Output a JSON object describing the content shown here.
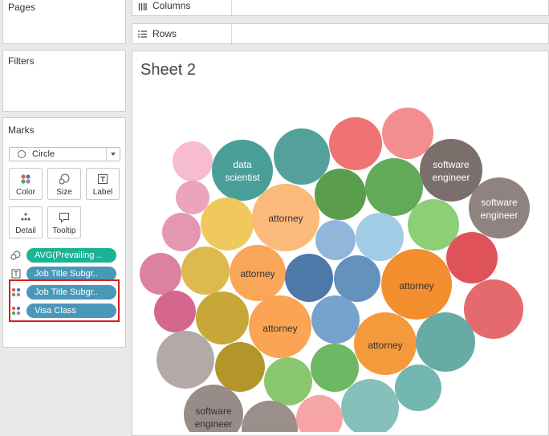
{
  "side": {
    "pages_title": "Pages",
    "filters_title": "Filters",
    "marks_title": "Marks",
    "mark_type": "Circle",
    "buttons": [
      {
        "label": "Color",
        "icon": "color-icon"
      },
      {
        "label": "Size",
        "icon": "size-icon"
      },
      {
        "label": "Label",
        "icon": "label-icon"
      },
      {
        "label": "Detail",
        "icon": "detail-icon"
      },
      {
        "label": "Tooltip",
        "icon": "tooltip-icon"
      }
    ],
    "pills": [
      {
        "text": "AVG(Prevailing ..",
        "icon": "size-icon",
        "color": "#1bb393"
      },
      {
        "text": "Job Title Subgr..",
        "icon": "label-icon",
        "color": "#4a98b8"
      },
      {
        "text": "Job Title Subgr..",
        "icon": "color-icon",
        "color": "#4a98b8"
      },
      {
        "text": "Visa Class",
        "icon": "color-icon",
        "color": "#4a98b8"
      }
    ]
  },
  "shelves": {
    "columns": "Columns",
    "rows": "Rows"
  },
  "sheet": {
    "title": "Sheet 2"
  },
  "chart_data": {
    "type": "packed-bubble",
    "labels_shown": [
      "data scientist",
      "software engineer",
      "software engineer",
      "attorney",
      "attorney",
      "attorney",
      "attorney",
      "attorney",
      "software engineer"
    ]
  }
}
